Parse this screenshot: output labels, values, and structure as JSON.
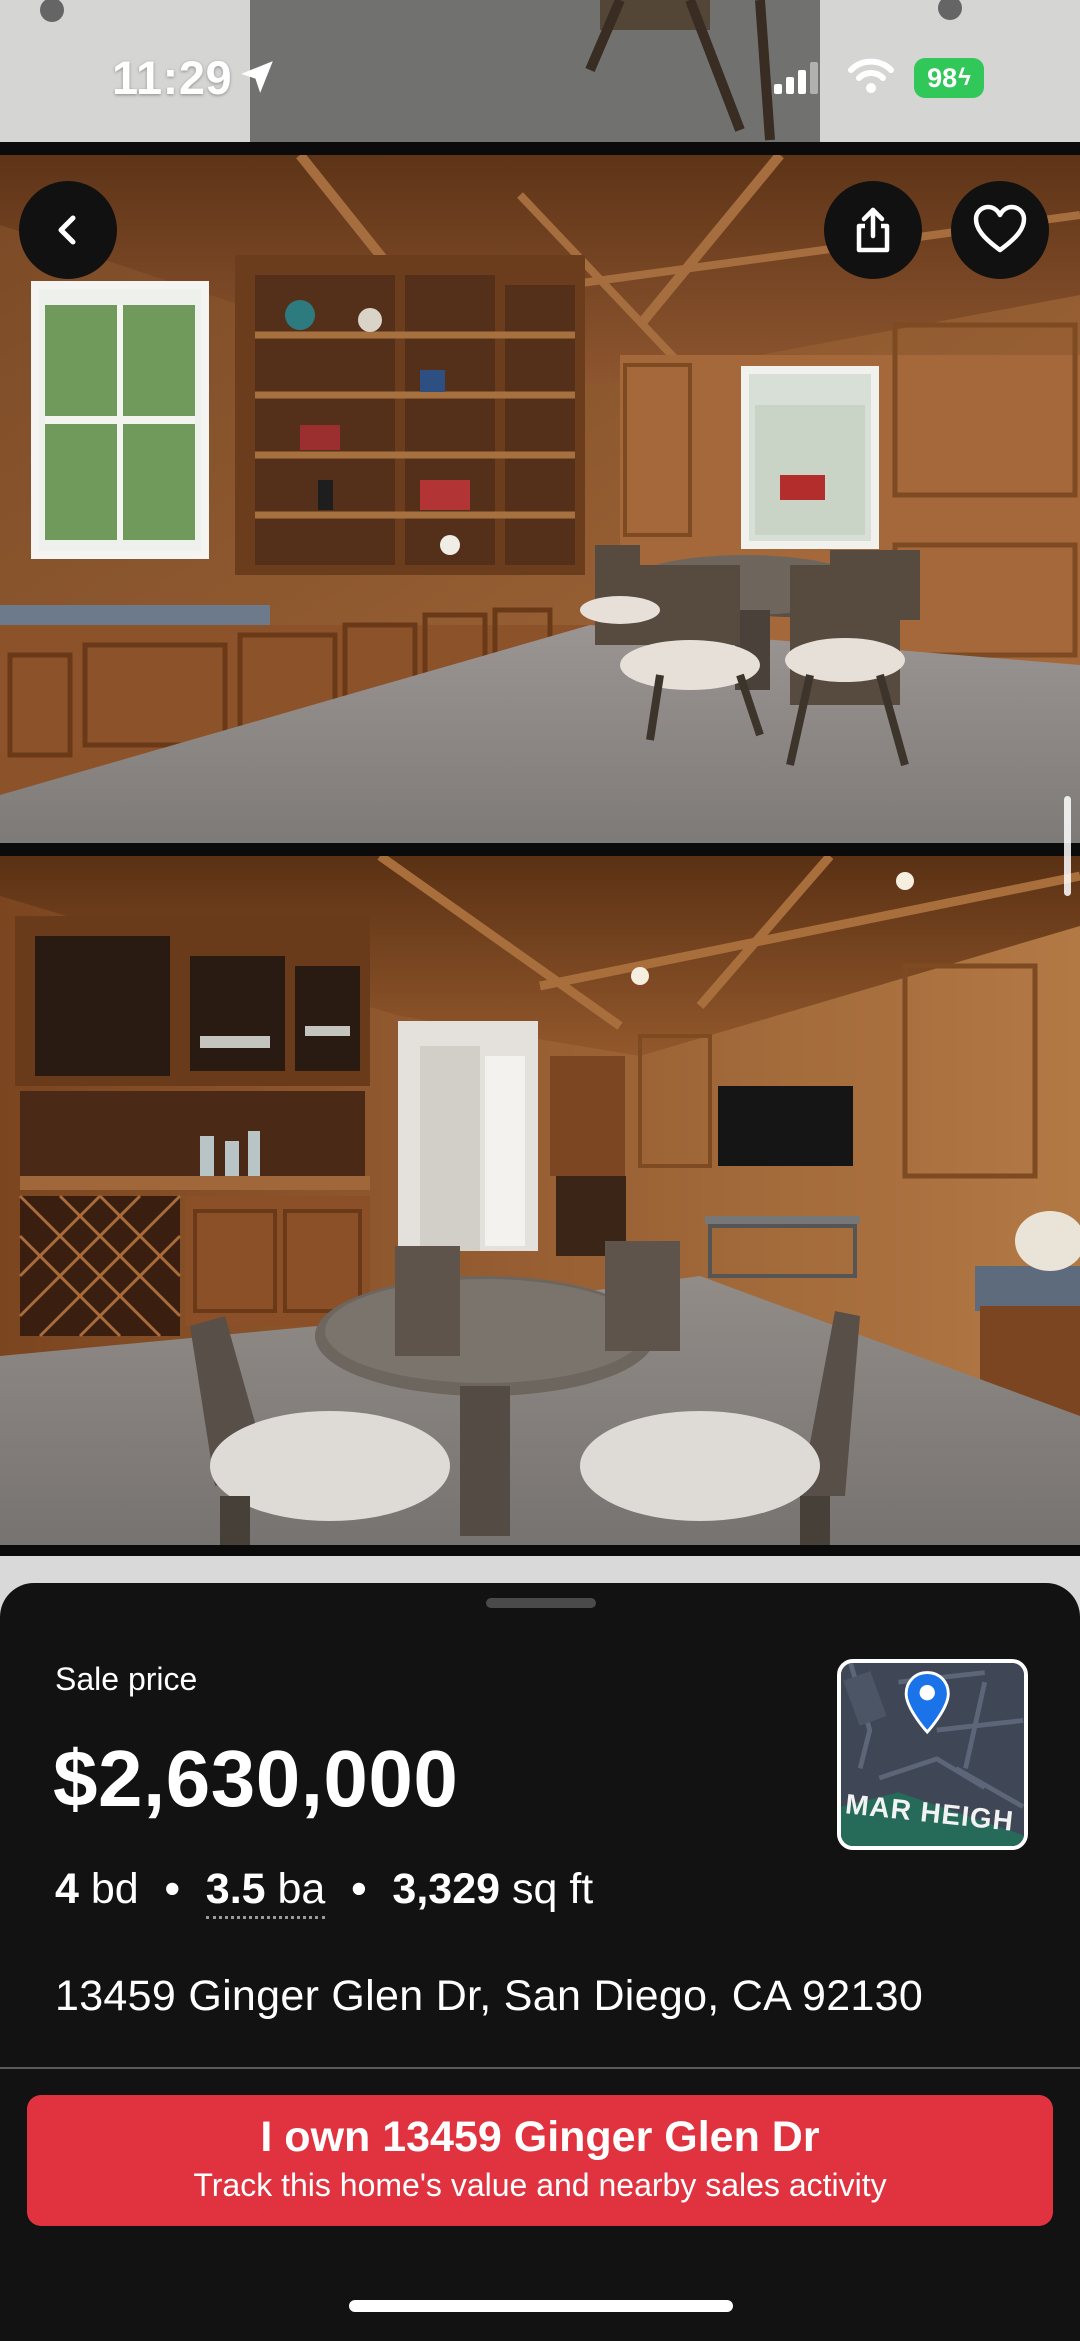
{
  "status_bar": {
    "time": "11:29",
    "battery": "98",
    "battery_color": "#32c759"
  },
  "nav": {
    "back_icon": "chevron-left-icon",
    "share_icon": "share-icon",
    "favorite_icon": "heart-icon"
  },
  "listing": {
    "sale_label": "Sale price",
    "price": "$2,630,000",
    "beds": "4",
    "beds_unit": "bd",
    "baths": "3.5",
    "baths_unit": "ba",
    "sqft": "3,329",
    "sqft_unit": "sq ft",
    "separator": "•",
    "address": "13459 Ginger Glen Dr, San Diego, CA 92130"
  },
  "map": {
    "street_label": "MAR HEIGH",
    "pin_icon": "map-pin-icon",
    "pin_color": "#1a73e8"
  },
  "cta": {
    "title": "I own 13459 Ginger Glen Dr",
    "subtitle": "Track this home's value and nearby sales activity",
    "color": "#e0333f"
  }
}
